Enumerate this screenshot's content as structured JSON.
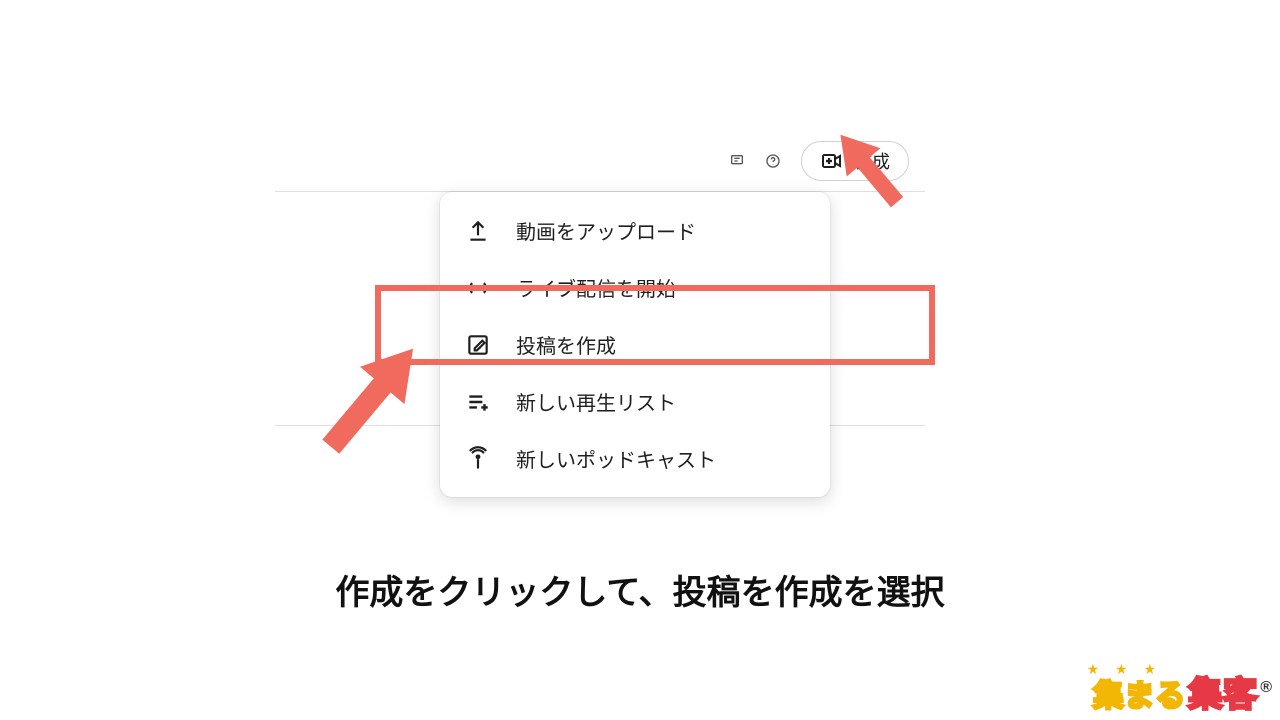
{
  "topbar": {
    "create_label": "作成"
  },
  "menu": {
    "items": [
      {
        "label": "動画をアップロード",
        "icon": "upload-icon"
      },
      {
        "label": "ライブ配信を開始",
        "icon": "live-icon"
      },
      {
        "label": "投稿を作成",
        "icon": "compose-icon"
      },
      {
        "label": "新しい再生リスト",
        "icon": "playlist-add-icon"
      },
      {
        "label": "新しいポッドキャスト",
        "icon": "podcast-icon"
      }
    ]
  },
  "caption": "作成をクリックして、投稿を作成を選択",
  "brand": {
    "part1": "集まる",
    "part2": "集客",
    "reg": "®"
  },
  "annotations": {
    "highlight_color": "#f16a5e"
  }
}
